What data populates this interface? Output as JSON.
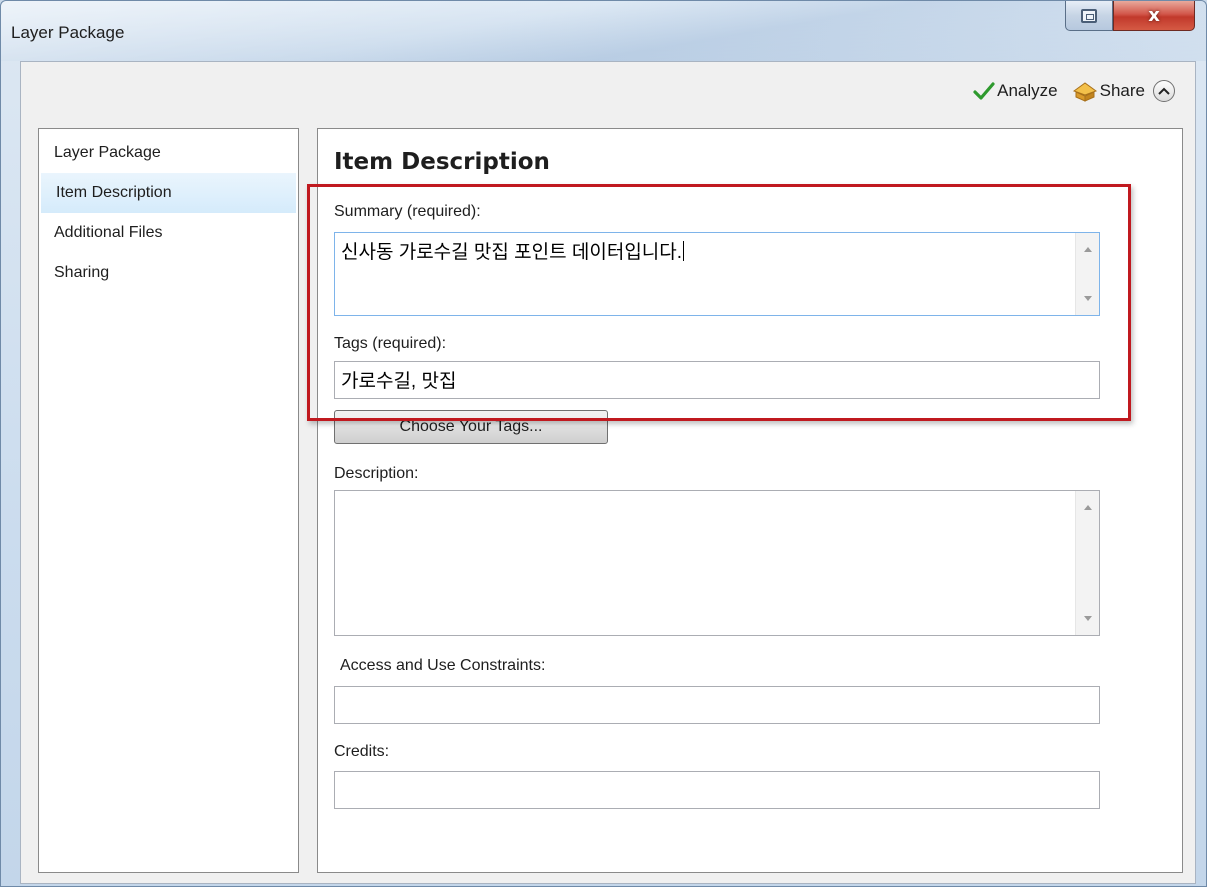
{
  "window": {
    "title": "Layer Package",
    "close_glyph": "x"
  },
  "toolbar": {
    "analyze_label": "Analyze",
    "share_label": "Share"
  },
  "sidebar": {
    "items": [
      {
        "label": "Layer Package",
        "active": false
      },
      {
        "label": "Item Description",
        "active": true
      },
      {
        "label": "Additional Files",
        "active": false
      },
      {
        "label": "Sharing",
        "active": false
      }
    ]
  },
  "panel": {
    "title": "Item Description",
    "summary": {
      "label": "Summary (required):",
      "value": "신사동 가로수길 맛집 포인트 데이터입니다."
    },
    "tags": {
      "label": "Tags (required):",
      "value": "가로수길, 맛집"
    },
    "choose_tags_label": "Choose Your Tags...",
    "description": {
      "label": "Description:",
      "value": ""
    },
    "access": {
      "label": "Access and Use Constraints:",
      "value": ""
    },
    "credits": {
      "label": "Credits:",
      "value": ""
    }
  },
  "colors": {
    "highlight_border": "#c0191f",
    "active_item_bg": "#d5ebfb",
    "check_green": "#2e9a2e"
  }
}
